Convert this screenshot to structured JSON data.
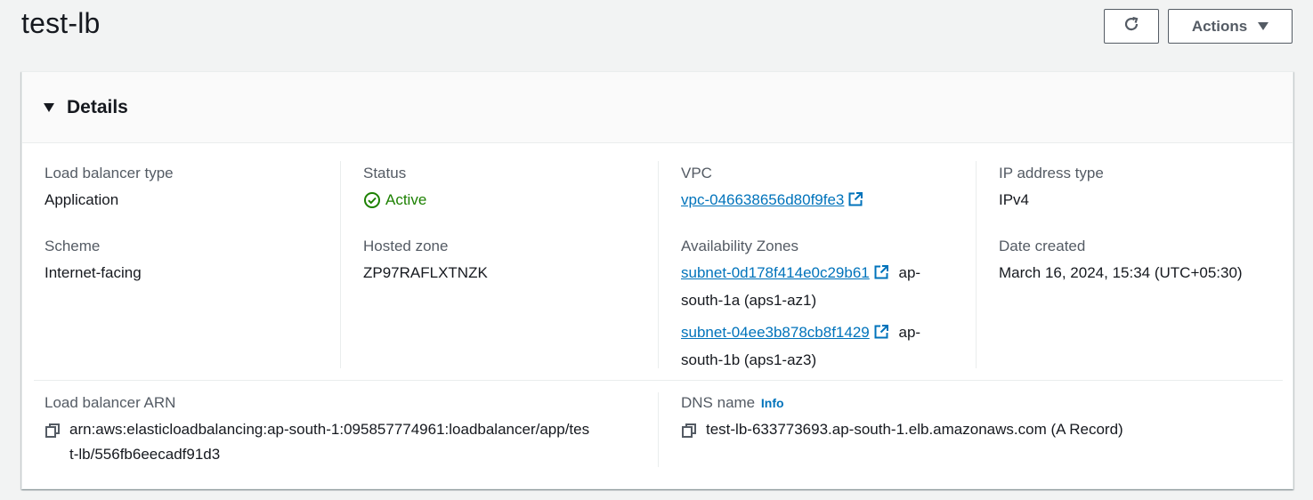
{
  "header": {
    "title": "test-lb",
    "actions_label": "Actions"
  },
  "details": {
    "title": "Details",
    "lb_type": {
      "label": "Load balancer type",
      "value": "Application"
    },
    "status": {
      "label": "Status",
      "value": "Active"
    },
    "vpc": {
      "label": "VPC",
      "value": "vpc-046638656d80f9fe3"
    },
    "ip_type": {
      "label": "IP address type",
      "value": "IPv4"
    },
    "scheme": {
      "label": "Scheme",
      "value": "Internet-facing"
    },
    "hosted_zone": {
      "label": "Hosted zone",
      "value": "ZP97RAFLXTNZK"
    },
    "azs": {
      "label": "Availability Zones",
      "items": [
        {
          "subnet": "subnet-0d178f414e0c29b61",
          "suffix1": "ap-",
          "suffix2": "south-1a (aps1-az1)"
        },
        {
          "subnet": "subnet-04ee3b878cb8f1429",
          "suffix1": "ap-",
          "suffix2": "south-1b (aps1-az3)"
        }
      ]
    },
    "date_created": {
      "label": "Date created",
      "value": "March 16, 2024, 15:34 (UTC+05:30)"
    },
    "arn": {
      "label": "Load balancer ARN",
      "line1": "arn:aws:elasticloadbalancing:ap-south-1:095857774961:loadbalancer/app/tes",
      "line2": "t-lb/556fb6eecadf91d3"
    },
    "dns": {
      "label": "DNS name",
      "info": "Info",
      "value": "test-lb-633773693.ap-south-1.elb.amazonaws.com (A Record)"
    }
  },
  "colors": {
    "link": "#0073bb",
    "success": "#1d8102",
    "label": "#545b64",
    "text": "#16191f"
  },
  "icons": [
    "refresh-icon",
    "caret-down-icon",
    "caret-expanded-icon",
    "success-check-icon",
    "external-link-icon",
    "copy-icon"
  ]
}
